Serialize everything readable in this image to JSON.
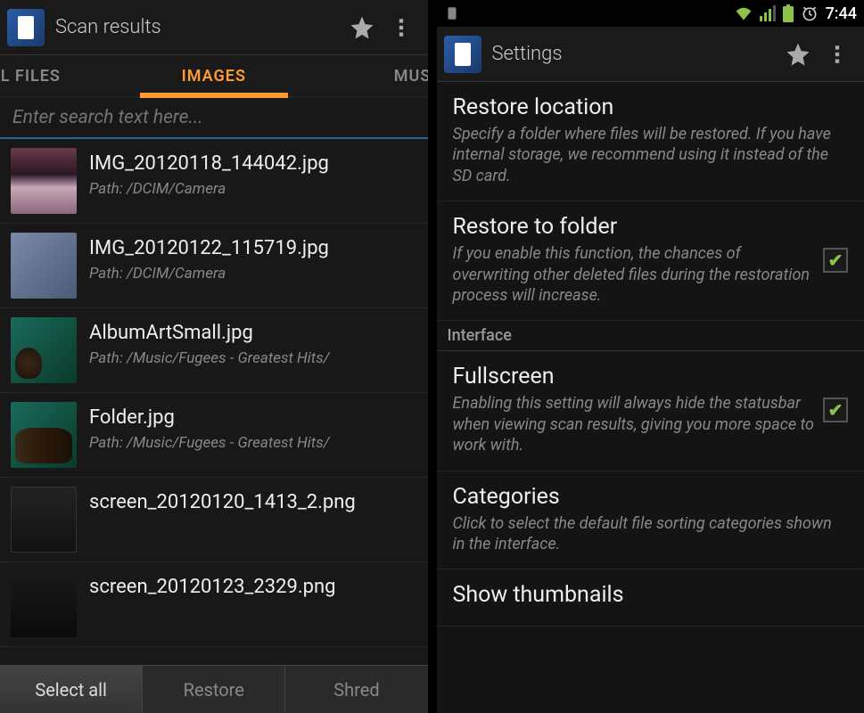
{
  "left": {
    "title": "Scan results",
    "tabs": [
      "LL FILES",
      "IMAGES",
      "MUSI"
    ],
    "active_tab": 1,
    "search_placeholder": "Enter search text here...",
    "files": [
      {
        "name": "IMG_20120118_144042.jpg",
        "path": "Path: /DCIM/Camera"
      },
      {
        "name": "IMG_20120122_115719.jpg",
        "path": "Path: /DCIM/Camera"
      },
      {
        "name": "AlbumArtSmall.jpg",
        "path": "Path: /Music/Fugees - Greatest Hits/"
      },
      {
        "name": "Folder.jpg",
        "path": "Path: /Music/Fugees - Greatest Hits/"
      },
      {
        "name": "screen_20120120_1413_2.png",
        "path": ""
      },
      {
        "name": "screen_20120123_2329.png",
        "path": ""
      }
    ],
    "buttons": {
      "select_all": "Select all",
      "restore": "Restore",
      "shred": "Shred"
    }
  },
  "right": {
    "status_time": "7:44",
    "title": "Settings",
    "section_interface": "Interface",
    "items": [
      {
        "title": "Restore location",
        "desc": "Specify a folder where files will be restored. If you have internal storage, we recommend using it instead of the SD card.",
        "checkbox": null
      },
      {
        "title": "Restore to folder",
        "desc": "If you enable this function, the chances of overwriting other deleted files during the restoration process will increase.",
        "checkbox": true
      },
      {
        "title": "Fullscreen",
        "desc": "Enabling this setting will always hide the statusbar when viewing scan results, giving you more space to work with.",
        "checkbox": true
      },
      {
        "title": "Categories",
        "desc": "Click to select the default file sorting categories shown in the interface.",
        "checkbox": null
      },
      {
        "title": "Show thumbnails",
        "desc": "",
        "checkbox": null
      }
    ]
  }
}
